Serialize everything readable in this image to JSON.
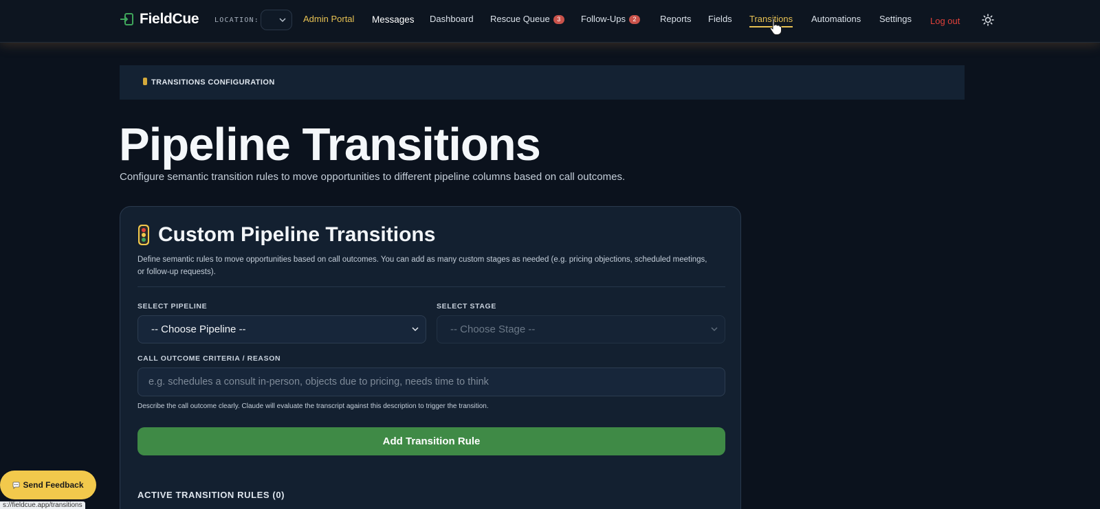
{
  "brand": {
    "name": "FieldCue"
  },
  "location": {
    "label": "LOCATION:"
  },
  "nav": {
    "admin_portal": "Admin Portal",
    "messages": "Messages",
    "dashboard": "Dashboard",
    "rescue_queue": "Rescue Queue",
    "rescue_queue_count": "3",
    "follow_ups": "Follow-Ups",
    "follow_ups_count": "2",
    "reports": "Reports",
    "fields": "Fields",
    "transitions": "Transitions",
    "automations": "Automations",
    "settings": "Settings",
    "logout": "Log out"
  },
  "banner": {
    "text": "TRANSITIONS CONFIGURATION"
  },
  "page": {
    "title": "Pipeline Transitions",
    "subtitle": "Configure semantic transition rules to move opportunities to different pipeline columns based on call outcomes."
  },
  "card": {
    "title": "Custom Pipeline Transitions",
    "description": "Define semantic rules to move opportunities based on call outcomes. You can add as many custom stages as needed (e.g. pricing objections, scheduled meetings, or follow-up requests).",
    "pipeline_label": "SELECT PIPELINE",
    "pipeline_value": "-- Choose Pipeline --",
    "stage_label": "SELECT STAGE",
    "stage_value": "-- Choose Stage --",
    "criteria_label": "CALL OUTCOME CRITERIA / REASON",
    "criteria_placeholder": "e.g. schedules a consult in-person, objects due to pricing, needs time to think",
    "help_text": "Describe the call outcome clearly. Claude will evaluate the transcript against this description to trigger the transition.",
    "add_button": "Add Transition Rule",
    "active_rules": "ACTIVE TRANSITION RULES (0)"
  },
  "feedback": {
    "label": "Send Feedback"
  },
  "status_bar": {
    "url": "s://fieldcue.app/transitions"
  },
  "colors": {
    "accent": "#e8c253",
    "logout": "#e0413a",
    "primary_button": "#3f8a46",
    "feedback_button": "#f2c94c",
    "badge": "#c9524a"
  },
  "icons": [
    "logo-icon",
    "chevron-down-icon",
    "sun-icon",
    "traffic-light-icon",
    "speech-bubble-icon",
    "cursor-icon"
  ]
}
